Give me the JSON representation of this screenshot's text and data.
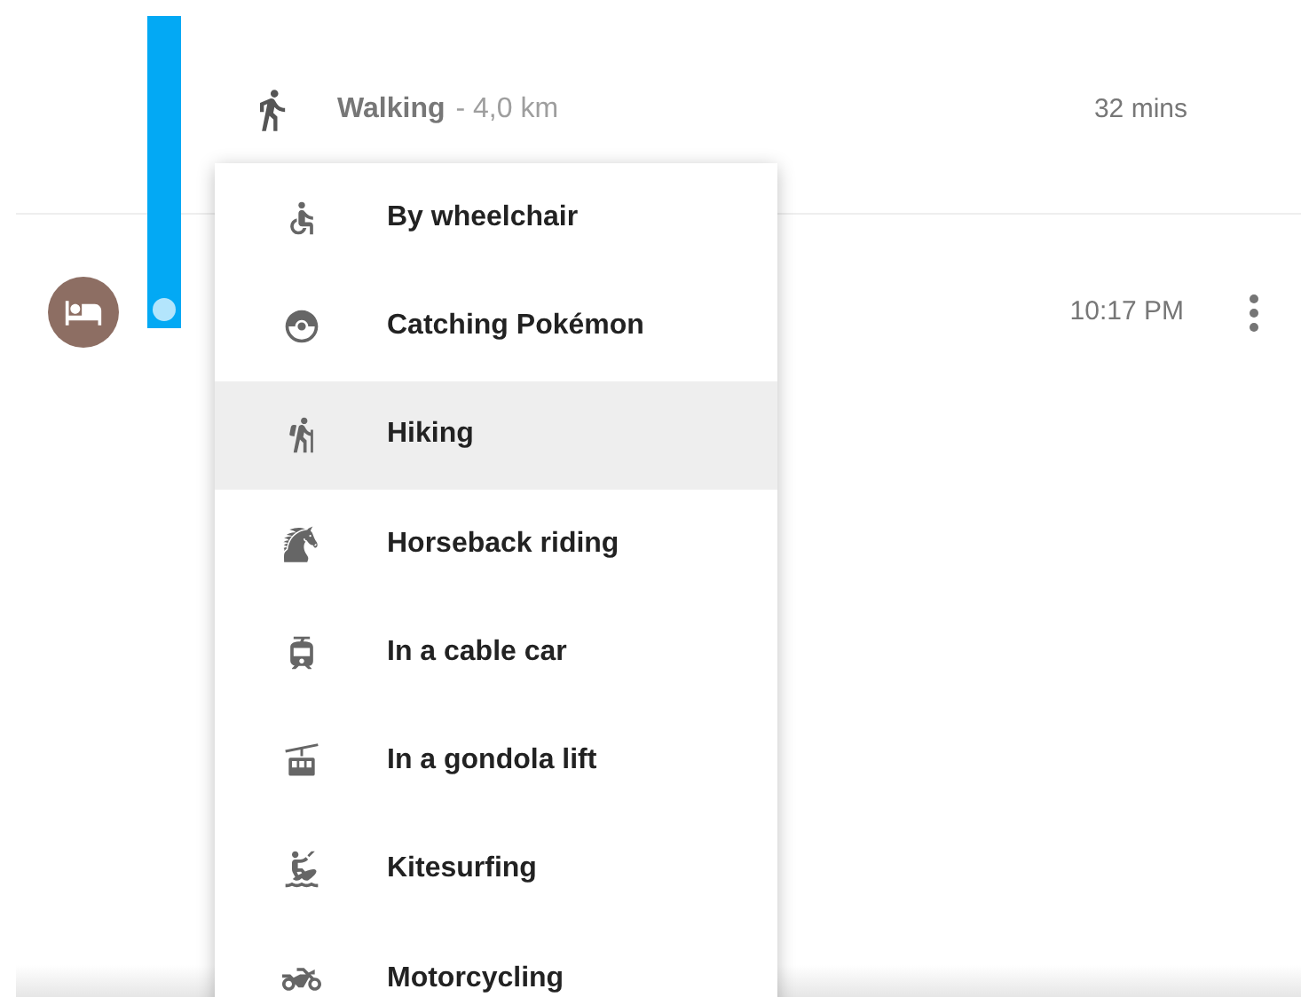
{
  "walking_row": {
    "label": "Walking",
    "distance": "- 4,0 km",
    "duration": "32 mins"
  },
  "stop_row": {
    "time": "10:17 PM"
  },
  "menu": {
    "items": [
      {
        "label": "By wheelchair",
        "selected": false
      },
      {
        "label": "Catching Pokémon",
        "selected": false
      },
      {
        "label": "Hiking",
        "selected": true
      },
      {
        "label": "Horseback riding",
        "selected": false
      },
      {
        "label": "In a cable car",
        "selected": false
      },
      {
        "label": "In a gondola lift",
        "selected": false
      },
      {
        "label": "Kitesurfing",
        "selected": false
      },
      {
        "label": "Motorcycling",
        "selected": false
      }
    ]
  }
}
